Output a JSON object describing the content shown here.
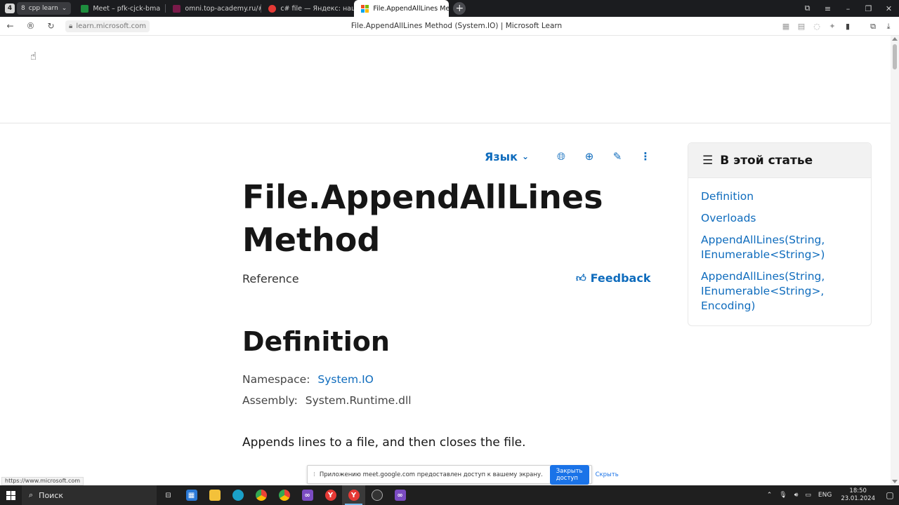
{
  "browser": {
    "tab_count": "4",
    "tab_group": {
      "count": "8",
      "label": "cpp learn"
    },
    "tabs": [
      {
        "label": "Meet – pfk-cjck-bma",
        "color": "#1e8e3e"
      },
      {
        "label": "omni.top-academy.ru/#/p",
        "color": "#7a1a4a"
      },
      {
        "label": "c# file — Яндекс: нашлось",
        "color": "#e53935"
      },
      {
        "label": "File.AppendAllLines Met",
        "color": "#f25022"
      }
    ],
    "url": "learn.microsoft.com",
    "page_title": "File.AppendAllLines Method (System.IO) | Microsoft Learn"
  },
  "article": {
    "language_label": "Язык",
    "title": "File.AppendAllLines Method",
    "subtitle": "Reference",
    "feedback": "Feedback",
    "section_heading": "Definition",
    "namespace_label": "Namespace:",
    "namespace_value": "System.IO",
    "assembly_label": "Assembly:",
    "assembly_value": "System.Runtime.dll",
    "summary": "Appends lines to a file, and then closes the file."
  },
  "toc": {
    "heading": "В этой статье",
    "items": [
      "Definition",
      "Overloads",
      "AppendAllLines(String, IEnumerable<String>)",
      "AppendAllLines(String, IEnumerable<String>, Encoding)"
    ]
  },
  "status_url": "https://www.microsoft.com",
  "share_bar": {
    "message": "Приложению meet.google.com предоставлен доступ к вашему экрану.",
    "stop_label": "Закрыть доступ",
    "hide_label": "Скрыть"
  },
  "taskbar": {
    "search_label": "Поиск",
    "language": "ENG",
    "time": "18:50",
    "date": "23.01.2024"
  },
  "colors": {
    "accent": "#0f6cbd",
    "share_button": "#1a73e8"
  }
}
